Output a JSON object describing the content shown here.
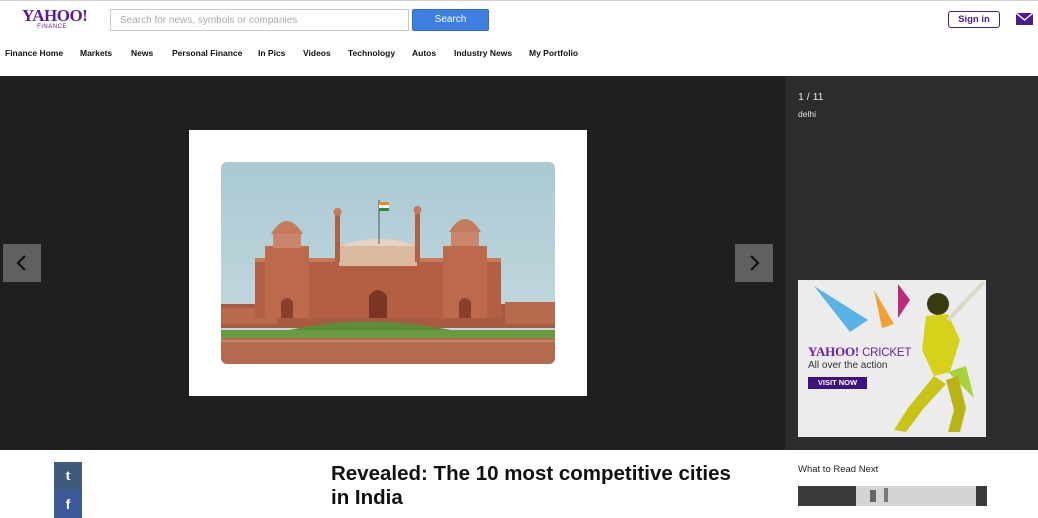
{
  "header": {
    "logo_text": "YAHOO!",
    "logo_subtext": "FINANCE",
    "search_placeholder": "Search for news, symbols or companies",
    "search_button": "Search",
    "signin_button": "Sign in"
  },
  "nav": {
    "items": [
      "Finance Home",
      "Markets",
      "News",
      "Personal Finance",
      "In Pics",
      "Videos",
      "Technology",
      "Autos",
      "Industry News",
      "My Portfolio"
    ]
  },
  "slideshow": {
    "counter": "1 / 11",
    "caption": "delhi"
  },
  "ad": {
    "brand_yahoo": "YAHOO!",
    "brand_cricket": "CRICKET",
    "tagline": "All over the action",
    "cta": "VISIT NOW"
  },
  "article": {
    "headline": "Revealed: The 10 most competitive cities in India"
  },
  "share": {
    "tumblr_glyph": "t",
    "facebook_glyph": "f"
  },
  "sidebar": {
    "read_next_title": "What to Read Next"
  },
  "colors": {
    "brand": "#5a1aa0",
    "search_button": "#3c7fe0",
    "stage": "#1f1f1f"
  }
}
